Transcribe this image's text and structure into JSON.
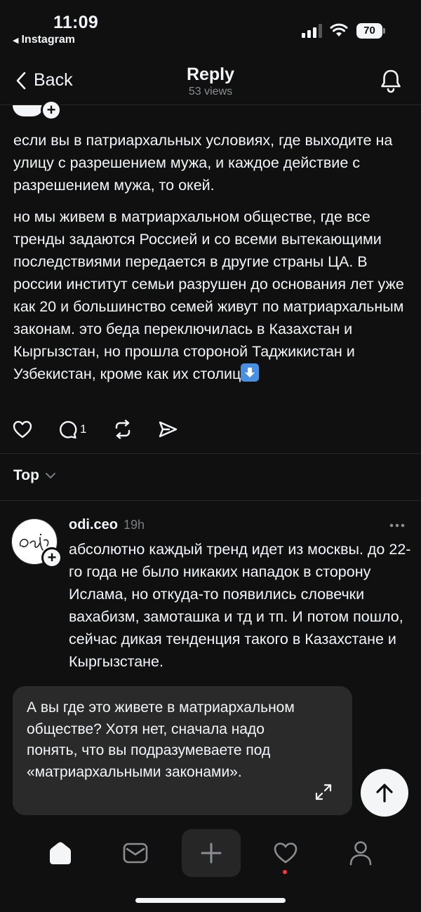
{
  "status_bar": {
    "time": "11:09",
    "back_app": "Instagram",
    "battery": "70"
  },
  "header": {
    "back_label": "Back",
    "title": "Reply",
    "subtitle": "53 views"
  },
  "post": {
    "paragraph1": "если вы в патриархальных условиях, где выходите на улицу с разрешением мужа, и каждое действие с разрешением мужа, то окей.",
    "paragraph2": "но мы живем в матриархальном обществе, где все тренды задаются Россией и со всеми вытекающими последствиями передается в другие страны ЦА. В россии институт семьи разрушен до основания лет уже как 20 и большинство семей живут по матриархальным законам. это беда переключилась в Казахстан и Кыргызстан, но прошла стороной Таджикистан и Узбекистан, кроме как их столиц",
    "emoji": "down-arrow-emoji",
    "reply_count": "1"
  },
  "sort": {
    "label": "Top"
  },
  "comment": {
    "username": "odi.ceo",
    "time": "19h",
    "text": "абсолютно каждый тренд идет из москвы. до 22-го года не было никаких нападок в сторону Ислама, но откуда-то появились словечки вахабизм, замоташка и тд и тп. И потом пошло, сейчас дикая тенденция такого в Казахстане и Кыргызстане."
  },
  "reply_draft": {
    "text": "А вы где это живете в матриархальном обществе? Хотя нет, сначала надо понять, что вы подразумеваете под «матриархальными законами»."
  },
  "colors": {
    "background": "#101010",
    "text": "#f3f5f7",
    "muted": "#8a8d91",
    "bubble": "#2a2a2a",
    "notification_dot": "#ff3040"
  },
  "icons": {
    "like": "heart-icon",
    "comment": "comment-icon",
    "repost": "repost-icon",
    "share": "send-icon",
    "home": "home-icon",
    "inbox": "inbox-icon",
    "create": "plus-icon",
    "activity": "heart-icon",
    "profile": "profile-icon"
  }
}
